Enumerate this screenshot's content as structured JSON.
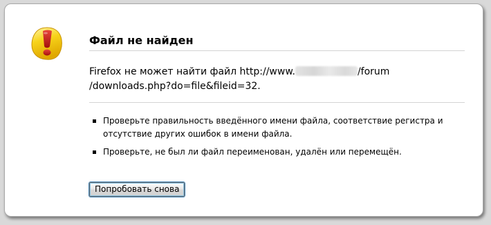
{
  "error_page": {
    "title": "Файл не найден",
    "message_prefix": "Firefox не может найти файл http://www.",
    "message_suffix": "/forum /downloads.php?do=file&fileid=32.",
    "tips": [
      "Проверьте правильность введённого имени файла, соответствие регистра и отсутствие других ошибок в имени файла.",
      "Проверьте, не был ли файл переименован, удалён или перемещён."
    ],
    "retry_button_label": "Попробовать снова"
  },
  "icons": {
    "warning": "warning-exclamation-icon"
  },
  "colors": {
    "background": "#d9d9d9",
    "panel": "#ffffff",
    "icon_yellow": "#f5d10c",
    "icon_red": "#c81a17",
    "button_focus": "#3c7fb1"
  }
}
